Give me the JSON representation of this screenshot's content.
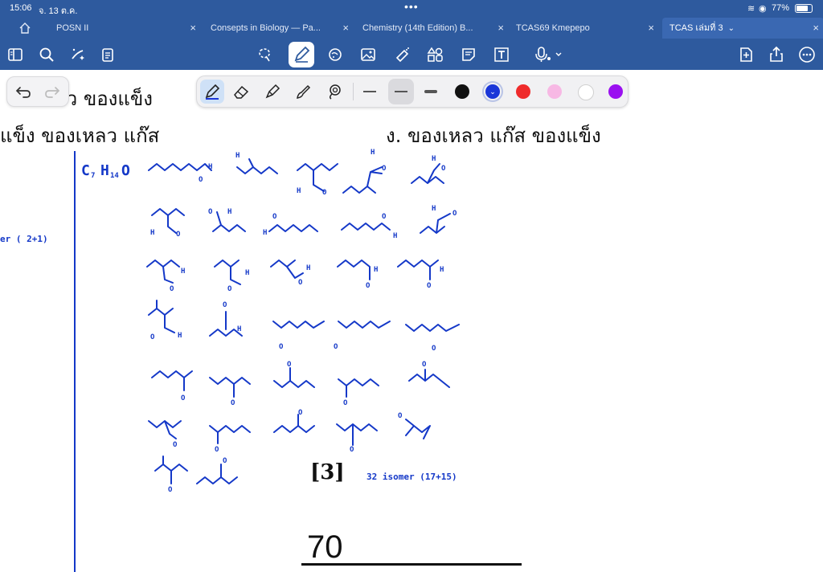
{
  "status_bar": {
    "time": "15:06",
    "date": "จ. 13 ต.ค.",
    "battery": "77%"
  },
  "tabs": [
    {
      "label": "POSN II"
    },
    {
      "label": "Consepts in Biology — Pa..."
    },
    {
      "label": "Chemistry (14th Edition) B..."
    },
    {
      "label": "TCAS69 Kmepepo"
    },
    {
      "label": "TCAS เล่มที่ 3"
    }
  ],
  "toolbar": {
    "left_icons": [
      "sidebar-icon",
      "search-icon",
      "magic-icon",
      "clipboard-icon"
    ],
    "center_icons": [
      "lasso-icon",
      "pen-icon",
      "shape-icon",
      "image-icon",
      "tape-icon",
      "elements-icon",
      "sticky-note-icon",
      "text-box-icon",
      "microphone-icon"
    ],
    "right_icons": [
      "add-page-icon",
      "share-icon",
      "more-icon"
    ]
  },
  "pen_toolbar": {
    "tools": [
      "fountain-pen-icon",
      "eraser-icon",
      "highlighter-icon",
      "brush-icon",
      "lasso-rope-icon"
    ],
    "colors": [
      "#111111",
      "#1a36d8",
      "#ef2b2b",
      "#f7b8e4",
      "#ffffff",
      "#9a10f0"
    ],
    "selected_color": "#1a36d8"
  },
  "document": {
    "line1_text": "ลว ของแข็ง",
    "line2_left_text": "แข็ง ของเหลว แก๊ส",
    "line2_right_text": "ง. ของเหลว แก๊ส ของแข็ง",
    "formula_c": "C",
    "formula_c_sub": "7",
    "formula_h": "H",
    "formula_h_sub": "14",
    "formula_o": "O",
    "margin_note": "er ( 2+1)",
    "answer_ref": "[3]",
    "isomer_count": "32 isomer (17+15)",
    "page_number": "70"
  }
}
